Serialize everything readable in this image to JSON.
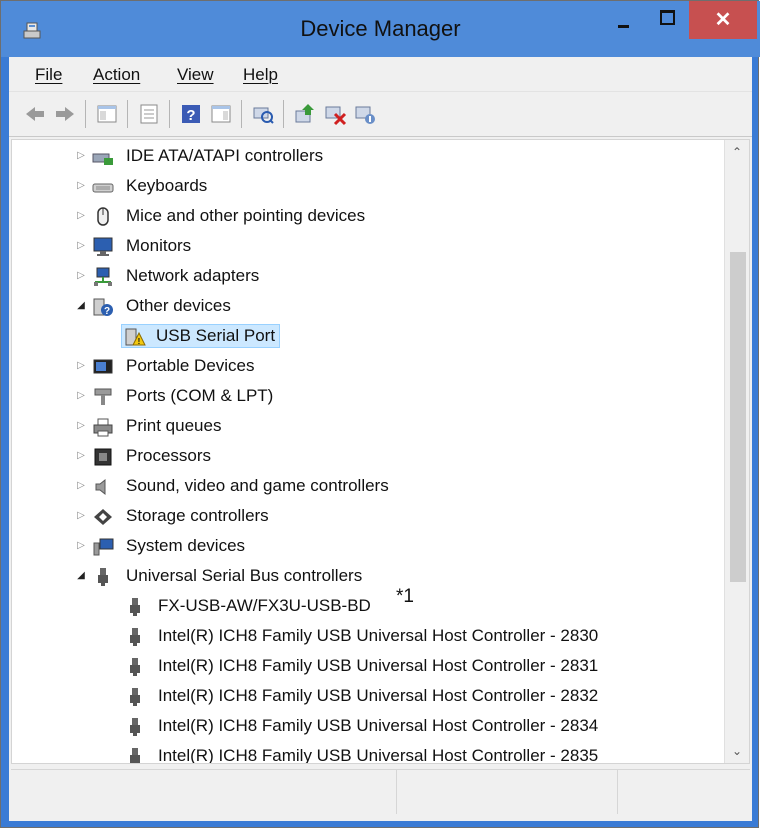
{
  "window": {
    "title": "Device Manager",
    "close_glyph": "✕",
    "colors": {
      "titlebar": "#4f8bd9",
      "close": "#c75050",
      "selection": "#cce8ff"
    }
  },
  "menu": [
    {
      "label": "File"
    },
    {
      "label": "Action"
    },
    {
      "label": "View"
    },
    {
      "label": "Help"
    }
  ],
  "toolbar": [
    {
      "icon": "back-arrow-icon"
    },
    {
      "icon": "forward-arrow-icon"
    },
    {
      "icon": "show-hide-console-tree-icon"
    },
    {
      "icon": "properties-icon"
    },
    {
      "icon": "help-icon"
    },
    {
      "icon": "show-action-pane-icon"
    },
    {
      "icon": "scan-hardware-changes-icon"
    },
    {
      "icon": "update-driver-icon"
    },
    {
      "icon": "uninstall-device-icon"
    },
    {
      "icon": "disable-device-icon"
    }
  ],
  "tree": [
    {
      "label": "IDE ATA/ATAPI controllers",
      "icon": "ide-controller-icon",
      "expanded": false,
      "level": 0
    },
    {
      "label": "Keyboards",
      "icon": "keyboard-icon",
      "expanded": false,
      "level": 0
    },
    {
      "label": "Mice and other pointing devices",
      "icon": "mouse-icon",
      "expanded": false,
      "level": 0
    },
    {
      "label": "Monitors",
      "icon": "monitor-icon",
      "expanded": false,
      "level": 0
    },
    {
      "label": "Network adapters",
      "icon": "network-adapter-icon",
      "expanded": false,
      "level": 0
    },
    {
      "label": "Other devices",
      "icon": "unknown-device-icon",
      "expanded": true,
      "level": 0
    },
    {
      "label": "USB Serial Port",
      "icon": "warning-device-icon",
      "level": 1,
      "selected": true
    },
    {
      "label": "Portable Devices",
      "icon": "portable-device-icon",
      "expanded": false,
      "level": 0
    },
    {
      "label": "Ports (COM & LPT)",
      "icon": "port-icon",
      "expanded": false,
      "level": 0
    },
    {
      "label": "Print queues",
      "icon": "printer-icon",
      "expanded": false,
      "level": 0
    },
    {
      "label": "Processors",
      "icon": "processor-icon",
      "expanded": false,
      "level": 0
    },
    {
      "label": "Sound, video and game controllers",
      "icon": "speaker-icon",
      "expanded": false,
      "level": 0
    },
    {
      "label": "Storage controllers",
      "icon": "storage-controller-icon",
      "expanded": false,
      "level": 0
    },
    {
      "label": "System devices",
      "icon": "system-devices-icon",
      "expanded": false,
      "level": 0
    },
    {
      "label": "Universal Serial Bus controllers",
      "icon": "usb-icon",
      "expanded": true,
      "level": 0
    },
    {
      "label": "FX-USB-AW/FX3U-USB-BD",
      "icon": "usb-icon",
      "level": 1,
      "footnote": "*1"
    },
    {
      "label": "Intel(R) ICH8 Family USB Universal Host Controller - 2830",
      "icon": "usb-icon",
      "level": 1
    },
    {
      "label": "Intel(R) ICH8 Family USB Universal Host Controller - 2831",
      "icon": "usb-icon",
      "level": 1
    },
    {
      "label": "Intel(R) ICH8 Family USB Universal Host Controller - 2832",
      "icon": "usb-icon",
      "level": 1
    },
    {
      "label": "Intel(R) ICH8 Family USB Universal Host Controller - 2834",
      "icon": "usb-icon",
      "level": 1
    },
    {
      "label": "Intel(R) ICH8 Family USB Universal Host Controller - 2835",
      "icon": "usb-icon",
      "level": 1
    }
  ],
  "scrollbar": {
    "up_glyph": "⌃",
    "down_glyph": "⌄"
  }
}
